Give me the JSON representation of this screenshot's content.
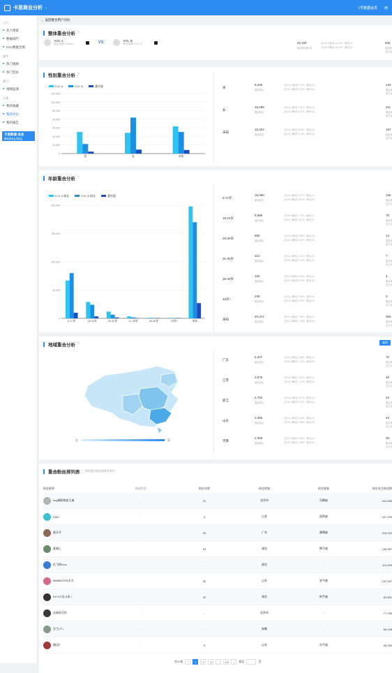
{
  "app": {
    "title": "卡思商业分析",
    "top_right": [
      "1号数据会员",
      "用"
    ]
  },
  "sidebar": {
    "groups": [
      {
        "label": "入口",
        "items": [
          "达人搜索",
          "数据排行",
          "KOL数据大盘"
        ]
      },
      {
        "label": "账号",
        "items": [
          "热门视频",
          "热门音乐"
        ]
      },
      {
        "label": "热门",
        "items": [
          "视频监测"
        ]
      },
      {
        "label": "工具",
        "items": [
          "我的收藏",
          "我的对比",
          "我的报告"
        ]
      }
    ],
    "banner_title": "卡思数据·会员",
    "banner_sub": "尊享更多会员权益"
  },
  "breadcrumb": "返回重合用户对比",
  "overall": {
    "title": "整体重合分析",
    "hint": "?",
    "kol_a": {
      "name": "KOL A",
      "sub": "粉丝总数 295,810"
    },
    "kol_b": {
      "name": "KOL B",
      "sub": "粉丝总数 273,071"
    },
    "vs": "VS",
    "metric": {
      "value": "42,100",
      "sub": "重合粉丝数 量",
      "text1": "占KOL A粉丝 14.23%（粉丝 A）",
      "text2": "占KOL B粉丝 15.42%（粉丝 B）",
      "rval": "625",
      "rsub": "重合粉丝占比"
    }
  },
  "gender": {
    "title": "性别重合分析",
    "hint": "?",
    "legend": [
      "KOL A",
      "KOL B",
      "重合量"
    ],
    "metrics": [
      {
        "label": "男",
        "value": "9,246",
        "sub": "重合粉丝",
        "t1": "占KOL A粉丝 2.07%（粉丝 A）",
        "t2": "占KOL B粉丝 2.24%（粉丝 B）",
        "rval": "133",
        "rsub": "重合粉丝占比"
      },
      {
        "label": "女",
        "value": "16,289",
        "sub": "重合粉丝",
        "t1": "占KOL A粉丝 4.31%（粉丝 A）",
        "t2": "占KOL B粉丝 4.67%（粉丝 B）",
        "rval": "211",
        "rsub": "重合粉丝占比"
      },
      {
        "label": "未知",
        "value": "15,324",
        "sub": "重合粉丝",
        "t1": "占KOL A粉丝 3.63%（粉丝 A）",
        "t2": "占KOL B粉丝 4.12%（粉丝 B）",
        "rval": "187",
        "rsub": "重合粉丝占比"
      }
    ]
  },
  "age": {
    "title": "年龄重合分析",
    "hint": "?",
    "legend": [
      "KOL A 粉丝",
      "KOL B 粉丝",
      "重合量"
    ],
    "metrics": [
      {
        "label": "6-17岁",
        "value": "15,399",
        "sub": "重合粉丝",
        "t1": "占KOL A粉丝 3.27%（粉丝 A）",
        "t2": "占KOL B粉丝 3.52%（粉丝 B）",
        "rval": "156",
        "rsub": "重合粉丝占比"
      },
      {
        "label": "18-24岁",
        "value": "5,896",
        "sub": "重合粉丝",
        "t1": "占KOL A粉丝 1.73%（粉丝 A）",
        "t2": "占KOL B粉丝 1.87%（粉丝 B）",
        "rval": "75",
        "rsub": "重合粉丝占比"
      },
      {
        "label": "25-30岁",
        "value": "880",
        "sub": "重合粉丝",
        "t1": "占KOL A粉丝 0.29%（粉丝 A）",
        "t2": "占KOL B粉丝 0.31%（粉丝 B）",
        "rval": "14",
        "rsub": "重合粉丝占比"
      },
      {
        "label": "31-35岁",
        "value": "312",
        "sub": "重合粉丝",
        "t1": "占KOL A粉丝 0.11%（粉丝 A）",
        "t2": "占KOL B粉丝 0.12%（粉丝 B）",
        "rval": "7",
        "rsub": "重合粉丝占比"
      },
      {
        "label": "36-40岁",
        "value": "116",
        "sub": "重合粉丝",
        "t1": "占KOL A粉丝 0.04%（粉丝 A）",
        "t2": "占KOL B粉丝 0.05%（粉丝 B）",
        "rval": "4",
        "rsub": "重合粉丝占比"
      },
      {
        "label": "40岁+",
        "value": "248",
        "sub": "重合粉丝",
        "t1": "占KOL A粉丝 0.08%（粉丝 A）",
        "t2": "占KOL B粉丝 0.09%（粉丝 B）",
        "rval": "3",
        "rsub": "重合粉丝占比"
      },
      {
        "label": "未知",
        "value": "20,414",
        "sub": "重合粉丝",
        "t1": "占KOL A粉丝 7.08%（粉丝 A）",
        "t2": "占KOL B粉丝 7.33%（粉丝 B）",
        "rval": "356",
        "rsub": "重合粉丝占比"
      }
    ]
  },
  "region": {
    "title": "地域重合分析",
    "hint": "?",
    "button": "省份",
    "scale_low": "低",
    "scale_high": "高",
    "metrics": [
      {
        "label": "广东",
        "value": "5,207",
        "sub": "重合粉丝",
        "t1": "占KOL A粉丝 1.68%（粉丝 A）",
        "t2": "占KOL B粉丝 1.78%（粉丝 B）",
        "rval": "70",
        "rsub": "重合粉丝占比"
      },
      {
        "label": "江苏",
        "value": "3,075",
        "sub": "重合粉丝",
        "t1": "占KOL A粉丝 1.01%（粉丝 A）",
        "t2": "占KOL B粉丝 1.10%（粉丝 B）",
        "rval": "45",
        "rsub": "重合粉丝占比"
      },
      {
        "label": "浙江",
        "value": "2,782",
        "sub": "重合粉丝",
        "t1": "占KOL A粉丝 0.97%（粉丝 A）",
        "t2": "占KOL B粉丝 1.01%（粉丝 B）",
        "rval": "34",
        "rsub": "重合粉丝占比"
      },
      {
        "label": "山东",
        "value": "2,395",
        "sub": "重合粉丝",
        "t1": "占KOL A粉丝 0.83%（粉丝 A）",
        "t2": "占KOL B粉丝 0.88%（粉丝 B）",
        "rval": "33",
        "rsub": "重合粉丝占比"
      },
      {
        "label": "河南",
        "value": "2,306",
        "sub": "重合粉丝",
        "t1": "占KOL A粉丝 0.80%（粉丝 A）",
        "t2": "占KOL B粉丝 0.85%（粉丝 B）",
        "rval": "30",
        "rsub": "重合粉丝占比"
      }
    ]
  },
  "ranking": {
    "title": "重合粉丝排列表",
    "sub": "（按照重合粉丝量降序排列）",
    "headers": [
      "粉丝昵称",
      "粉丝性别",
      "粉丝年龄",
      "粉丝地域",
      "粉丝星座",
      "粉丝关注粉丝数"
    ],
    "rows": [
      {
        "name": "kog辅助铁血王者",
        "gender": "-",
        "age": "31",
        "region": "北京市",
        "sign": "天蝎座",
        "count": "341,255",
        "color": "#b4b4b4"
      },
      {
        "name": "ZAKI",
        "gender": "-",
        "age": "3",
        "region": "江苏",
        "sign": "双鱼座",
        "count": "227,025",
        "color": "#3ec1d3"
      },
      {
        "name": "夏天不",
        "gender": "-",
        "age": "29",
        "region": "广东",
        "sign": "摩羯座",
        "count": "216,192",
        "color": "#8a6a55"
      },
      {
        "name": "麦香仁",
        "gender": "-",
        "age": "33",
        "region": "湖北",
        "sign": "狮子座",
        "count": "148,987",
        "color": "#6a8a6a"
      },
      {
        "name": "红飞地Lina",
        "gender": "-",
        "age": "-",
        "region": "湖北",
        "sign": "-",
        "count": "114,299",
        "color": "#3a7bd5"
      },
      {
        "name": "MMM#20Tai大大",
        "gender": "-",
        "age": "30",
        "region": "山东",
        "sign": "金牛座",
        "count": "102,287",
        "color": "#d46a8a"
      },
      {
        "name": "Kei KO五斗米丨",
        "gender": "-",
        "age": "32",
        "region": "湖北",
        "sign": "射手座",
        "count": "83,891",
        "color": "#3a3030"
      },
      {
        "name": "比较好记住",
        "gender": "-",
        "age": "-",
        "region": "北京市",
        "sign": "-",
        "count": "77,789",
        "color": "#3a3a3a"
      },
      {
        "name": "方丁(人)",
        "gender": "-",
        "age": "-",
        "region": "安徽",
        "sign": "-",
        "count": "66,138",
        "color": "#8a9a8a"
      },
      {
        "name": "路边F",
        "gender": "-",
        "age": "9",
        "region": "山东",
        "sign": "天平座",
        "count": "35,169",
        "color": "#a03a3a"
      }
    ],
    "pager": {
      "total": "共10条",
      "pages": [
        "1",
        "2",
        "3",
        "...",
        "10"
      ],
      "jump_label": "跳至",
      "page_suffix": "页"
    }
  },
  "chart_data": [
    {
      "type": "bar",
      "title": "性别重合分析",
      "categories": [
        "男",
        "女",
        "未知"
      ],
      "series": [
        {
          "name": "KOL A",
          "values": [
            27000,
            26000,
            34000
          ]
        },
        {
          "name": "KOL B",
          "values": [
            12000,
            45000,
            27000
          ]
        },
        {
          "name": "重合量",
          "values": [
            2500,
            5000,
            4500
          ]
        }
      ],
      "yticks": [
        "120,000",
        "100,000",
        "80,000",
        "60,000",
        "40,000",
        "30,000",
        "20,000",
        "0"
      ],
      "ylim": [
        0,
        75000
      ],
      "colors": [
        "#2fc4f0",
        "#1a8fe3",
        "#1a4fc4"
      ]
    },
    {
      "type": "bar",
      "title": "年龄重合分析",
      "categories": [
        "6-17岁",
        "18-24岁",
        "25-30岁",
        "31-35岁",
        "36-40岁",
        "40岁+",
        "未知"
      ],
      "series": [
        {
          "name": "KOL A 粉丝",
          "values": [
            67000,
            29000,
            12000,
            3500,
            1000,
            800,
            198000
          ]
        },
        {
          "name": "KOL B 粉丝",
          "values": [
            80000,
            24000,
            6500,
            1800,
            700,
            600,
            170000
          ]
        },
        {
          "name": "重合量",
          "values": [
            10000,
            3500,
            1500,
            400,
            200,
            200,
            27000
          ]
        }
      ],
      "yticks": [
        "200,000",
        "150,000",
        "100,000",
        "50,000",
        "0"
      ],
      "ylim": [
        0,
        200000
      ],
      "colors": [
        "#2fc4f0",
        "#1a8fe3",
        "#1a4fc4"
      ]
    }
  ]
}
